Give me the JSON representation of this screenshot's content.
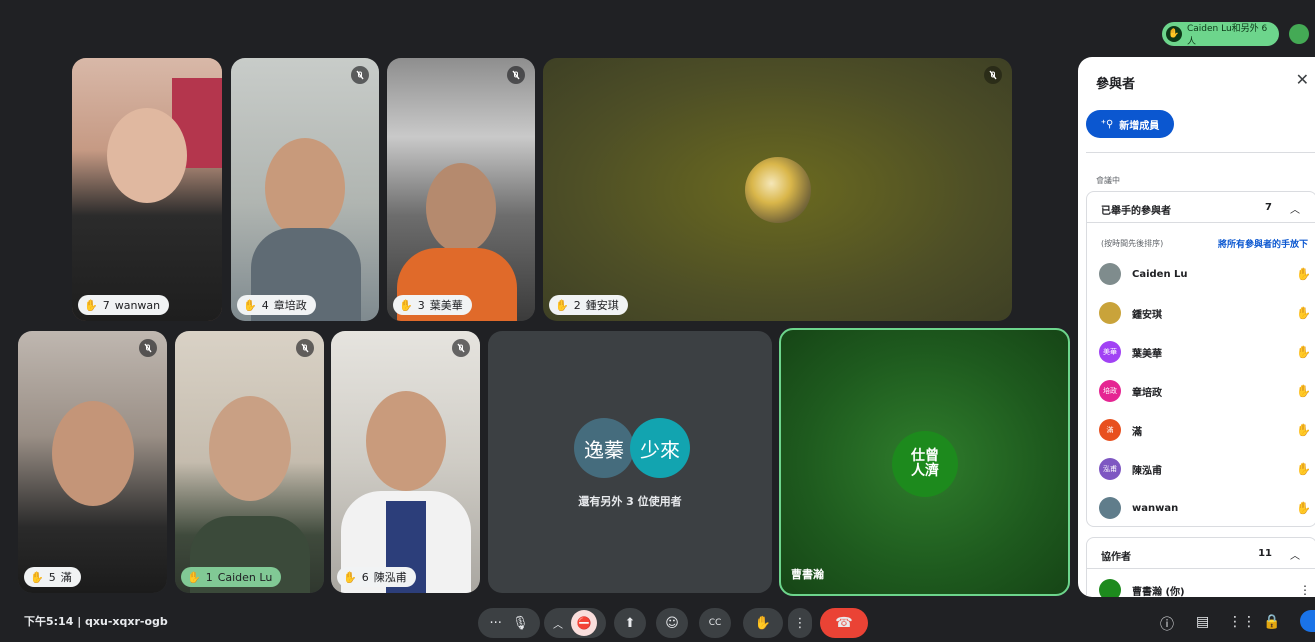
{
  "topbar": {
    "raised_hands_label": "Caiden Lu和另外 6 人"
  },
  "tiles": [
    {
      "name": "wanwan",
      "hand": "7"
    },
    {
      "name": "章培政",
      "hand": "4"
    },
    {
      "name": "葉美華",
      "hand": "3"
    },
    {
      "name": "鍾安琪",
      "hand": "2"
    },
    {
      "name": "滿",
      "hand": "5"
    },
    {
      "name": "Caiden Lu",
      "hand": "1"
    },
    {
      "name": "陳泓甫",
      "hand": "6"
    },
    {
      "name": "曹書瀚"
    }
  ],
  "others_tile": {
    "avatar1": "逸蓁",
    "avatar2": "少來",
    "label": "還有另外 3 位使用者"
  },
  "presenter_avatar_text": "仕曾人濟",
  "panel": {
    "title": "參與者",
    "add_button": "新增成員",
    "section_label": "會議中",
    "raised_group": {
      "title": "已舉手的參與者",
      "count": "7",
      "subtitle": "(按時間先後排序)",
      "lower_all": "將所有參與者的手放下",
      "rows": [
        {
          "name": "Caiden Lu",
          "avatar_text": "",
          "color": "#7f8c8d"
        },
        {
          "name": "鍾安琪",
          "avatar_text": "",
          "color": "#c9a33a"
        },
        {
          "name": "葉美華",
          "avatar_text": "美華",
          "color": "#a142f4"
        },
        {
          "name": "章培政",
          "avatar_text": "培政",
          "color": "#e52592"
        },
        {
          "name": "滿",
          "avatar_text": "滿",
          "color": "#e8501f"
        },
        {
          "name": "陳泓甫",
          "avatar_text": "泓甫",
          "color": "#7e57c2"
        },
        {
          "name": "wanwan",
          "avatar_text": "",
          "color": "#607d8b"
        }
      ]
    },
    "collab_group": {
      "title": "協作者",
      "count": "11",
      "first_row": "曹書瀚 (你)"
    }
  },
  "bottom": {
    "time_code": "下午5:14 | qxu-xqxr-ogb"
  },
  "colors": {
    "bg": "#202124",
    "end_call": "#ea4335",
    "active_border": "#6dd58c"
  }
}
